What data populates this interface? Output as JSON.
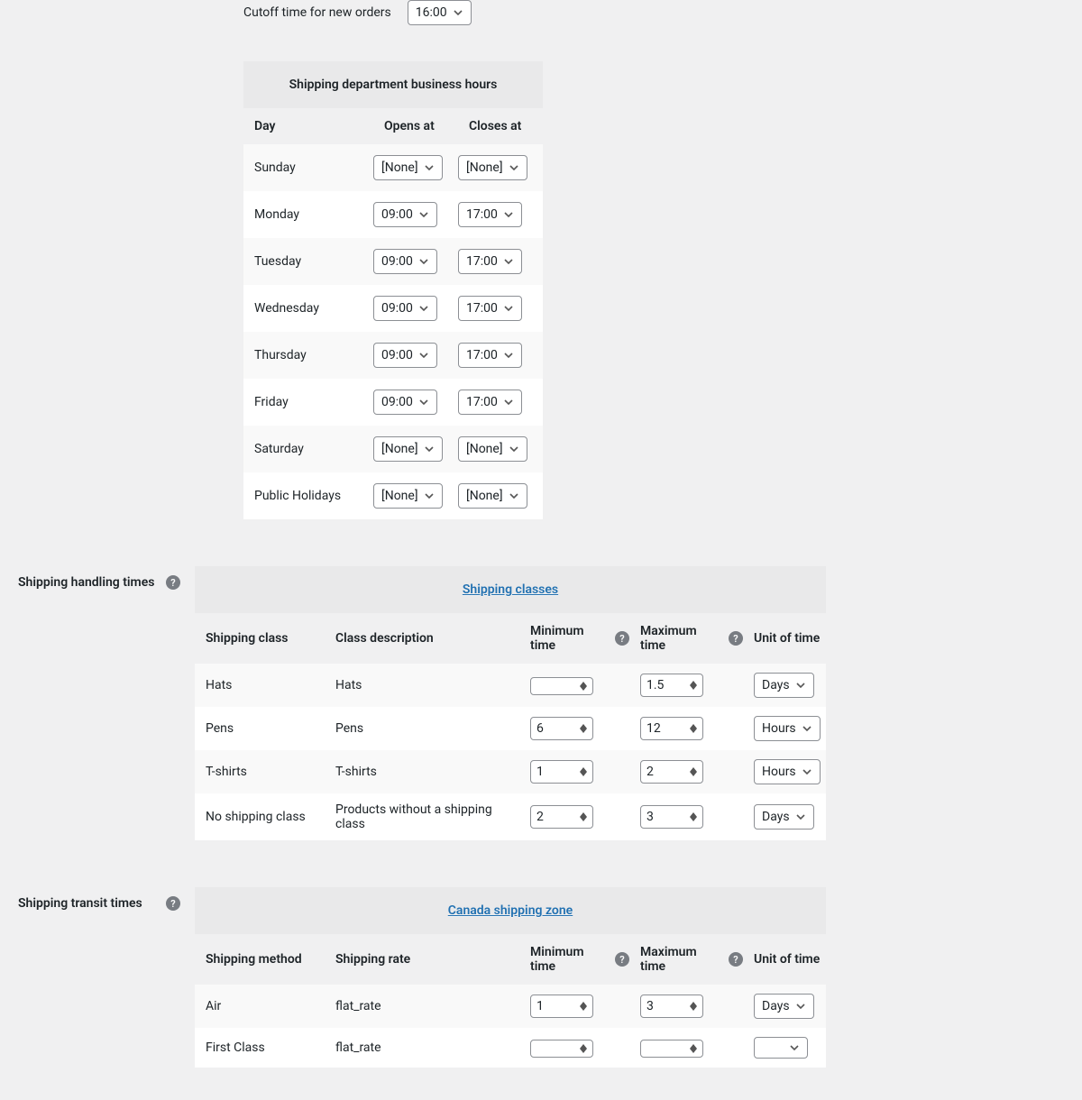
{
  "cutoff": {
    "label": "Cutoff time for new orders",
    "value": "16:00"
  },
  "hours": {
    "title": "Shipping department business hours",
    "cols": {
      "day": "Day",
      "opens": "Opens at",
      "closes": "Closes at"
    },
    "rows": [
      {
        "day": "Sunday",
        "opens": "[None]",
        "closes": "[None]"
      },
      {
        "day": "Monday",
        "opens": "09:00",
        "closes": "17:00"
      },
      {
        "day": "Tuesday",
        "opens": "09:00",
        "closes": "17:00"
      },
      {
        "day": "Wednesday",
        "opens": "09:00",
        "closes": "17:00"
      },
      {
        "day": "Thursday",
        "opens": "09:00",
        "closes": "17:00"
      },
      {
        "day": "Friday",
        "opens": "09:00",
        "closes": "17:00"
      },
      {
        "day": "Saturday",
        "opens": "[None]",
        "closes": "[None]"
      },
      {
        "day": "Public Holidays",
        "opens": "[None]",
        "closes": "[None]"
      }
    ]
  },
  "handling": {
    "section_label": "Shipping handling times",
    "header_link": "Shipping classes",
    "cols": {
      "class": "Shipping class",
      "desc": "Class description",
      "min": "Minimum time",
      "max": "Maximum time",
      "unit": "Unit of time"
    },
    "rows": [
      {
        "class": "Hats",
        "desc": "Hats",
        "min": "",
        "max": "1.5",
        "unit": "Days"
      },
      {
        "class": "Pens",
        "desc": "Pens",
        "min": "6",
        "max": "12",
        "unit": "Hours"
      },
      {
        "class": "T-shirts",
        "desc": "T-shirts",
        "min": "1",
        "max": "2",
        "unit": "Hours"
      },
      {
        "class": "No shipping class",
        "desc": "Products without a shipping class",
        "min": "2",
        "max": "3",
        "unit": "Days"
      }
    ]
  },
  "transit": {
    "section_label": "Shipping transit times",
    "header_link": "Canada shipping zone",
    "cols": {
      "method": "Shipping method",
      "rate": "Shipping rate",
      "min": "Minimum time",
      "max": "Maximum time",
      "unit": "Unit of time"
    },
    "rows": [
      {
        "method": "Air",
        "rate": "flat_rate",
        "min": "1",
        "max": "3",
        "unit": "Days"
      },
      {
        "method": "First Class",
        "rate": "flat_rate",
        "min": "",
        "max": "",
        "unit": ""
      }
    ]
  }
}
